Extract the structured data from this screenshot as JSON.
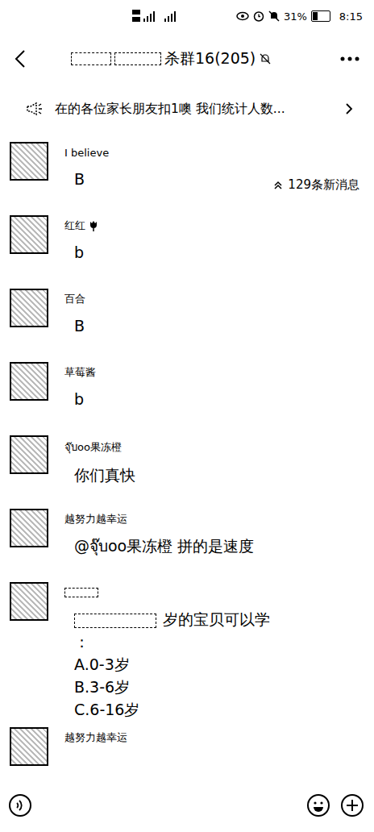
{
  "status_bar": {
    "time": "8:15",
    "battery": "31%",
    "battery_level": 0.31
  },
  "header": {
    "title": "杀群16(205)",
    "title_redacted": true,
    "muted": true
  },
  "notice": {
    "text": "在的各位家长朋友扣1噢 我们统计人数..."
  },
  "new_messages": {
    "label": "129条新消息"
  },
  "messages": [
    {
      "sender": "I    believe",
      "flower": false,
      "redacted": false,
      "lines": [
        "B"
      ]
    },
    {
      "sender": "红红",
      "flower": true,
      "redacted": false,
      "lines": [
        "b"
      ]
    },
    {
      "sender": "百合",
      "flower": false,
      "redacted": false,
      "lines": [
        "B"
      ]
    },
    {
      "sender": "草莓酱",
      "flower": false,
      "redacted": false,
      "lines": [
        "b"
      ]
    },
    {
      "sender": "จุ๊บoo果冻橙",
      "flower": false,
      "redacted": false,
      "lines": [
        "你们真快"
      ]
    },
    {
      "sender": "越努力越幸运",
      "flower": false,
      "redacted": false,
      "lines": [
        "@จุ๊บoo果冻橙 拼的是速度"
      ]
    },
    {
      "sender": "",
      "flower": false,
      "redacted": true,
      "lines": [
        "岁的宝贝可以学",
        "：",
        "A.0-3岁",
        "B.3-6岁",
        "C.6-16岁"
      ]
    },
    {
      "sender": "越努力越幸运",
      "flower": false,
      "redacted": false,
      "lines": []
    }
  ]
}
